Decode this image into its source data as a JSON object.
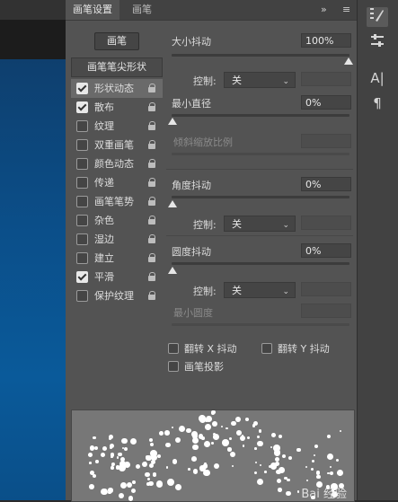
{
  "tabs": {
    "brush_settings": "画笔设置",
    "brush": "画笔"
  },
  "tabbar_controls": {
    "collapse": "»",
    "menu": "≡"
  },
  "brush_button": "画笔",
  "list_header": "画笔笔尖形状",
  "list_items": [
    {
      "label": "形状动态",
      "checked": true,
      "selected": true
    },
    {
      "label": "散布",
      "checked": true,
      "selected": false
    },
    {
      "label": "纹理",
      "checked": false,
      "selected": false
    },
    {
      "label": "双重画笔",
      "checked": false,
      "selected": false
    },
    {
      "label": "颜色动态",
      "checked": false,
      "selected": false
    },
    {
      "label": "传递",
      "checked": false,
      "selected": false
    },
    {
      "label": "画笔笔势",
      "checked": false,
      "selected": false
    },
    {
      "label": "杂色",
      "checked": false,
      "selected": false
    },
    {
      "label": "湿边",
      "checked": false,
      "selected": false
    },
    {
      "label": "建立",
      "checked": false,
      "selected": false
    },
    {
      "label": "平滑",
      "checked": true,
      "selected": false
    },
    {
      "label": "保护纹理",
      "checked": false,
      "selected": false
    }
  ],
  "size_jitter": {
    "label": "大小抖动",
    "value": "100%",
    "level": 1.0,
    "control_label": "控制:",
    "control_value": "关"
  },
  "min_diameter": {
    "label": "最小直径",
    "value": "0%",
    "level": 0.0
  },
  "tilt_scale": {
    "label": "倾斜缩放比例"
  },
  "angle_jitter": {
    "label": "角度抖动",
    "value": "0%",
    "level": 0.0,
    "control_label": "控制:",
    "control_value": "关"
  },
  "roundness_jitter": {
    "label": "圆度抖动",
    "value": "0%",
    "level": 0.0,
    "control_label": "控制:",
    "control_value": "关"
  },
  "min_roundness": {
    "label": "最小圆度"
  },
  "flip_x": {
    "label": "翻转 X 抖动",
    "checked": false
  },
  "flip_y": {
    "label": "翻转 Y 抖动",
    "checked": false
  },
  "brush_projection": {
    "label": "画笔投影",
    "checked": false
  },
  "watermark": "Bai 经验",
  "right_tools": [
    "brush-settings-icon",
    "adjust-sliders-icon",
    "character-icon",
    "paragraph-icon"
  ],
  "right_tool_glyphs": {
    "character": "A|",
    "paragraph": "¶"
  }
}
